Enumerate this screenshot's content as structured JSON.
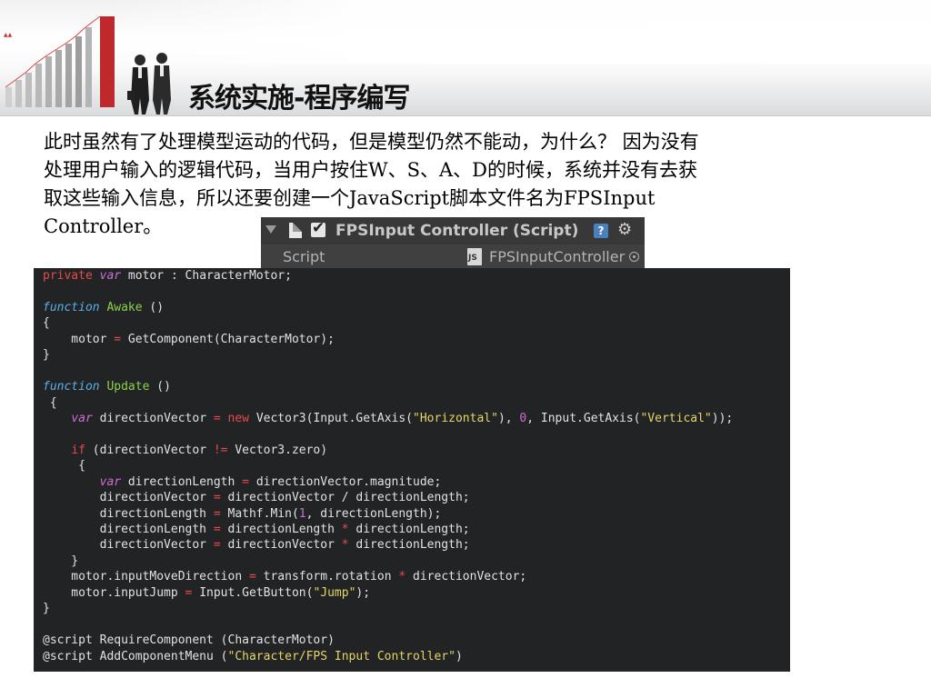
{
  "slide": {
    "title": "系统实施-程序编写",
    "paragraph_lines": [
      "此时虽然有了处理模型运动的代码，但是模型仍然不能动，为什么？ 因为没有",
      "处理用户输入的逻辑代码，当用户按住W、S、A、D的时候，系统并没有去获",
      "取这些输入信息，所以还要创建一个JavaScript脚本文件名为FPSInput",
      "Controller。"
    ]
  },
  "inspector": {
    "component_title": "FPSInput Controller (Script)",
    "help_label": "?",
    "gear_label": "⚙",
    "script_label": "Script",
    "script_value": "FPSInputController"
  },
  "code": {
    "lines": [
      [
        [
          "kw",
          "private"
        ],
        [
          "t",
          " "
        ],
        [
          "var",
          "var"
        ],
        [
          "t",
          " motor : CharacterMotor;"
        ]
      ],
      [],
      [
        [
          "kwi",
          "function"
        ],
        [
          "t",
          " "
        ],
        [
          "fn",
          "Awake"
        ],
        [
          "t",
          " ()"
        ]
      ],
      [
        [
          "t",
          "{"
        ]
      ],
      [
        [
          "t",
          "    motor "
        ],
        [
          "op",
          "="
        ],
        [
          "t",
          " GetComponent(CharacterMotor);"
        ]
      ],
      [
        [
          "t",
          "}"
        ]
      ],
      [],
      [
        [
          "kwi",
          "function"
        ],
        [
          "t",
          " "
        ],
        [
          "fn",
          "Update"
        ],
        [
          "t",
          " ()"
        ]
      ],
      [
        [
          "t",
          " {"
        ]
      ],
      [
        [
          "t",
          "    "
        ],
        [
          "var",
          "var"
        ],
        [
          "t",
          " directionVector "
        ],
        [
          "op",
          "="
        ],
        [
          "t",
          " "
        ],
        [
          "kw",
          "new"
        ],
        [
          "t",
          " Vector3(Input.GetAxis("
        ],
        [
          "str",
          "\"Horizontal\""
        ],
        [
          "t",
          "), "
        ],
        [
          "num",
          "0"
        ],
        [
          "t",
          ", Input.GetAxis("
        ],
        [
          "str",
          "\"Vertical\""
        ],
        [
          "t",
          "));"
        ]
      ],
      [],
      [
        [
          "t",
          "    "
        ],
        [
          "kw",
          "if"
        ],
        [
          "t",
          " (directionVector "
        ],
        [
          "op",
          "!="
        ],
        [
          "t",
          " Vector3.zero)"
        ]
      ],
      [
        [
          "t",
          "     {"
        ]
      ],
      [
        [
          "t",
          "        "
        ],
        [
          "var",
          "var"
        ],
        [
          "t",
          " directionLength "
        ],
        [
          "op",
          "="
        ],
        [
          "t",
          " directionVector.magnitude;"
        ]
      ],
      [
        [
          "t",
          "        directionVector "
        ],
        [
          "op",
          "="
        ],
        [
          "t",
          " directionVector / directionLength;"
        ]
      ],
      [
        [
          "t",
          "        directionLength "
        ],
        [
          "op",
          "="
        ],
        [
          "t",
          " Mathf.Min("
        ],
        [
          "num",
          "1"
        ],
        [
          "t",
          ", directionLength);"
        ]
      ],
      [
        [
          "t",
          "        directionLength "
        ],
        [
          "op",
          "="
        ],
        [
          "t",
          " directionLength "
        ],
        [
          "op",
          "*"
        ],
        [
          "t",
          " directionLength;"
        ]
      ],
      [
        [
          "t",
          "        directionVector "
        ],
        [
          "op",
          "="
        ],
        [
          "t",
          " directionVector "
        ],
        [
          "op",
          "*"
        ],
        [
          "t",
          " directionLength;"
        ]
      ],
      [
        [
          "t",
          "    }"
        ]
      ],
      [
        [
          "t",
          "    motor.inputMoveDirection "
        ],
        [
          "op",
          "="
        ],
        [
          "t",
          " transform.rotation "
        ],
        [
          "op",
          "*"
        ],
        [
          "t",
          " directionVector;"
        ]
      ],
      [
        [
          "t",
          "    motor.inputJump "
        ],
        [
          "op",
          "="
        ],
        [
          "t",
          " Input.GetButton("
        ],
        [
          "str",
          "\"Jump\""
        ],
        [
          "t",
          ");"
        ]
      ],
      [
        [
          "t",
          "}"
        ]
      ],
      [],
      [
        [
          "t",
          "@script RequireComponent (CharacterMotor)"
        ]
      ],
      [
        [
          "t",
          "@script AddComponentMenu ("
        ],
        [
          "str",
          "\"Character/FPS Input Controller\""
        ],
        [
          "t",
          ")"
        ]
      ]
    ]
  }
}
